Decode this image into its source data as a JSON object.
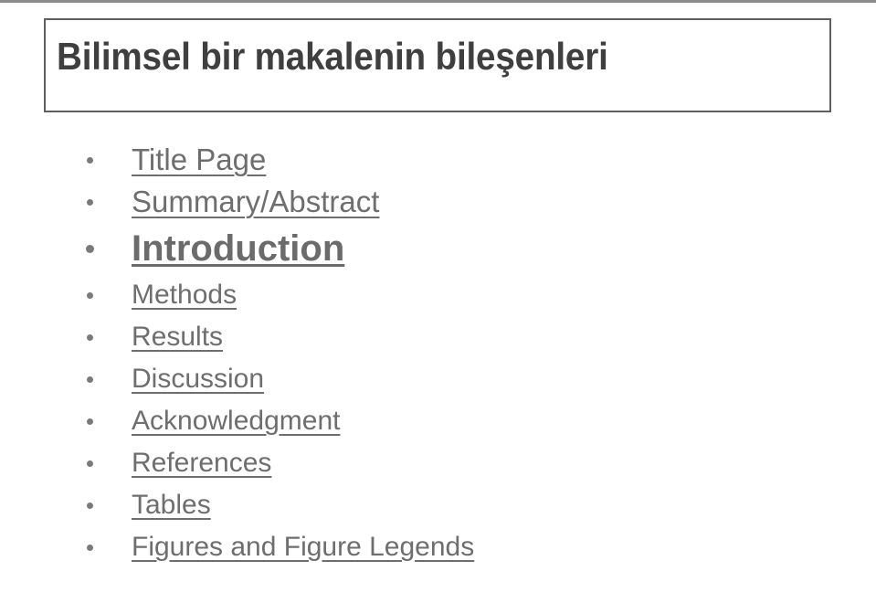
{
  "slide": {
    "title": "Bilimsel bir makalenin bileşenleri",
    "background_color": "#ffffff",
    "title_color": "#3f3f3f",
    "title_border_color": "#5f5f5f",
    "body_text_color": "#6e6e6e",
    "bullet_color": "#7a7a7a"
  },
  "outline": {
    "items": [
      {
        "label": "Title Page",
        "emphasis": false
      },
      {
        "label": "Summary/Abstract",
        "emphasis": false
      },
      {
        "label": "Introduction",
        "emphasis": true
      },
      {
        "label": "Methods",
        "emphasis": false
      },
      {
        "label": "Results",
        "emphasis": false
      },
      {
        "label": "Discussion",
        "emphasis": false
      },
      {
        "label": "Acknowledgment",
        "emphasis": false
      },
      {
        "label": "References",
        "emphasis": false
      },
      {
        "label": "Tables",
        "emphasis": false
      },
      {
        "label": "Figures and Figure Legends",
        "emphasis": false
      }
    ]
  }
}
